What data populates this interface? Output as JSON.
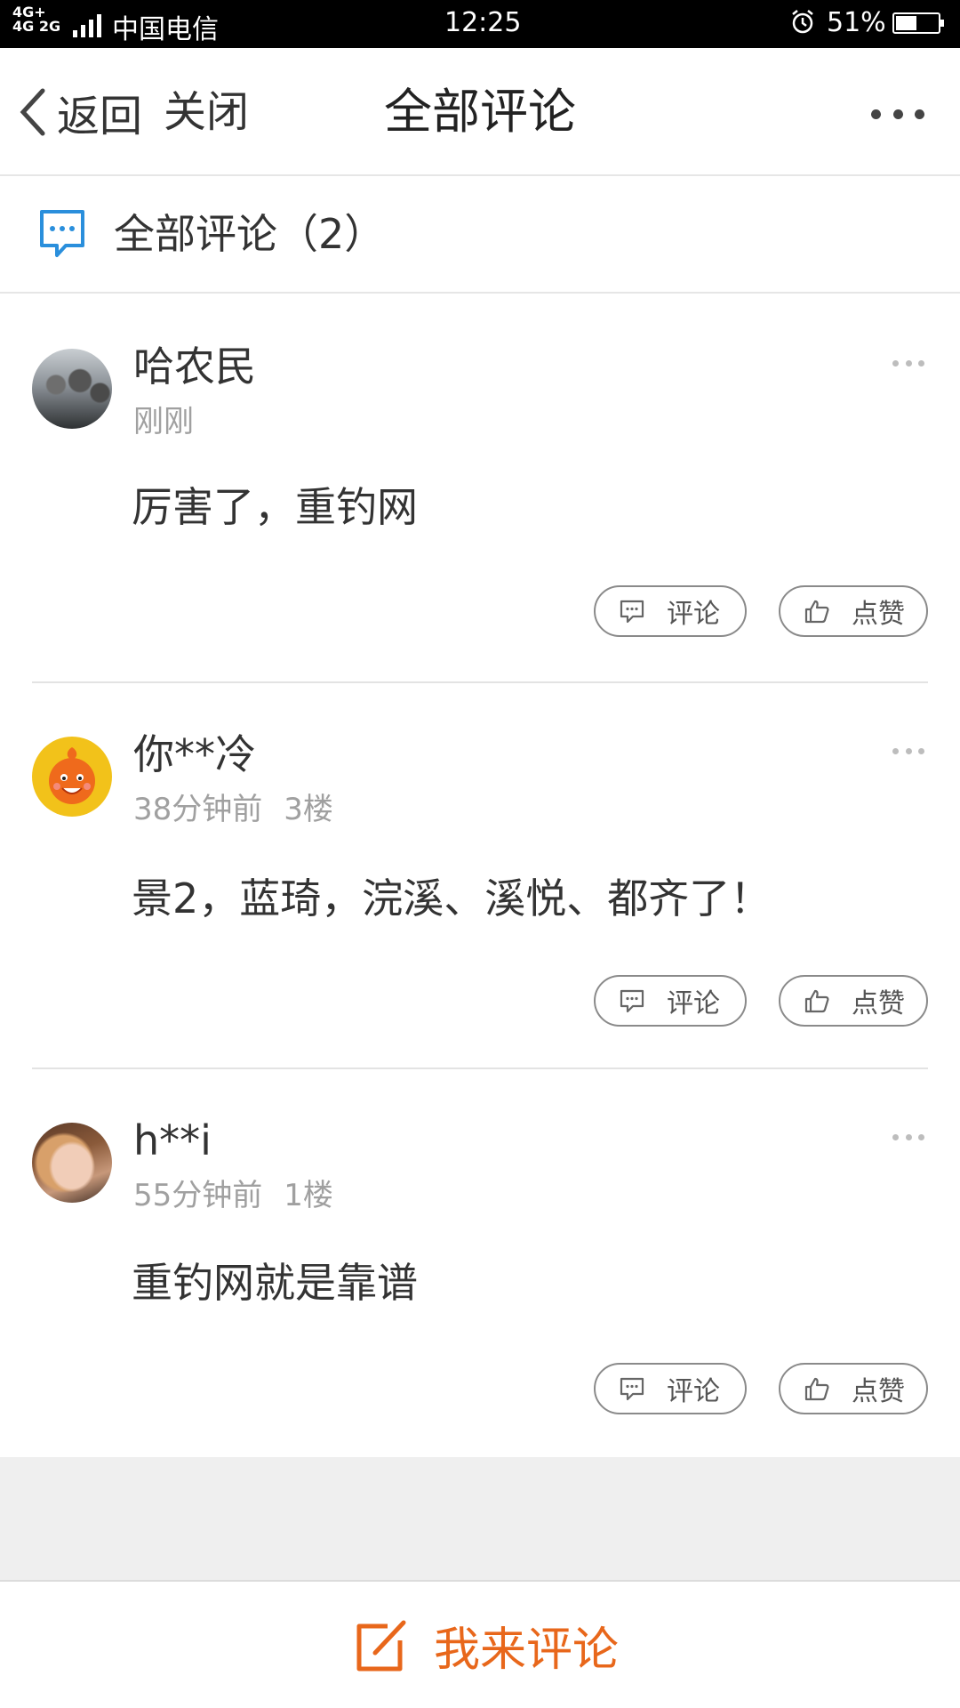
{
  "status_bar": {
    "network": "4G+ 4G 2G",
    "carrier": "中国电信",
    "time": "12:25",
    "battery": "51%",
    "battery_level": 0.51
  },
  "nav": {
    "back_label": "返回",
    "close_label": "关闭",
    "title": "全部评论"
  },
  "section": {
    "title": "全部评论（2）"
  },
  "comments": [
    {
      "user": "哈农民",
      "time": "刚刚",
      "floor": "",
      "text": "厉害了，重钓网",
      "comment_label": "评论",
      "like_label": "点赞"
    },
    {
      "user": "你**冷",
      "time": "38分钟前",
      "floor": "3楼",
      "text": "景2，蓝琦，浣溪、溪悦、都齐了！",
      "comment_label": "评论",
      "like_label": "点赞"
    },
    {
      "user": "h**i",
      "time": "55分钟前",
      "floor": "1楼",
      "text": "重钓网就是靠谱",
      "comment_label": "评论",
      "like_label": "点赞"
    }
  ],
  "bottom": {
    "write_label": "我来评论"
  },
  "colors": {
    "accent_orange": "#e8671b",
    "icon_blue": "#2a8fdc"
  }
}
